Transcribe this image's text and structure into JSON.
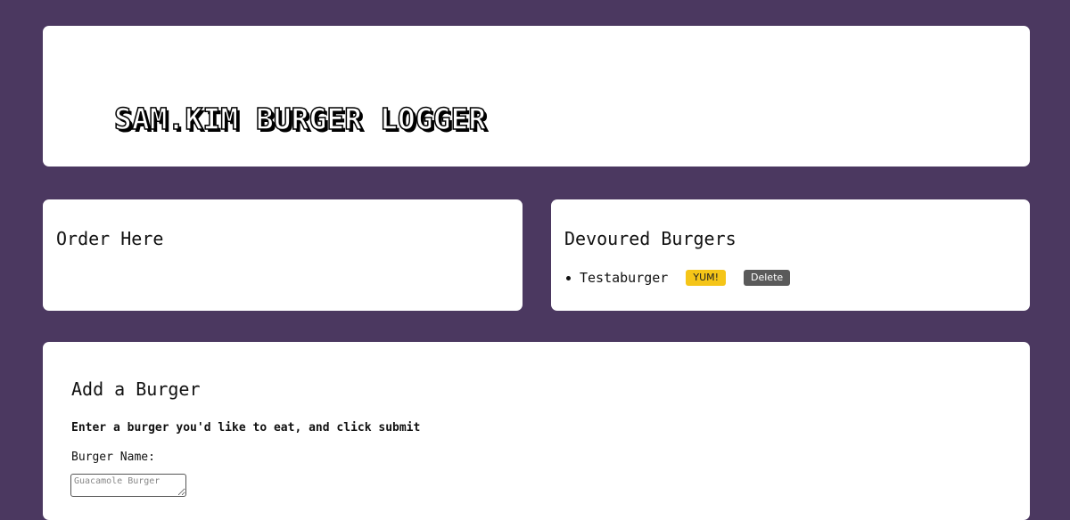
{
  "header": {
    "title": "SAM.KIM BURGER LOGGER"
  },
  "order_panel": {
    "title": "Order Here"
  },
  "devoured_panel": {
    "title": "Devoured Burgers",
    "items": [
      {
        "name": "Testaburger",
        "yum_label": "YUM!",
        "delete_label": "Delete"
      }
    ]
  },
  "add_panel": {
    "title": "Add a Burger",
    "subtitle": "Enter a burger you'd like to eat, and click submit",
    "field_label": "Burger Name:",
    "input_placeholder": "Guacamole Burger",
    "input_value": ""
  },
  "colors": {
    "background": "#4b3860",
    "card": "#ffffff",
    "yum_button": "#f5c518",
    "delete_button": "#5a5a5a"
  }
}
